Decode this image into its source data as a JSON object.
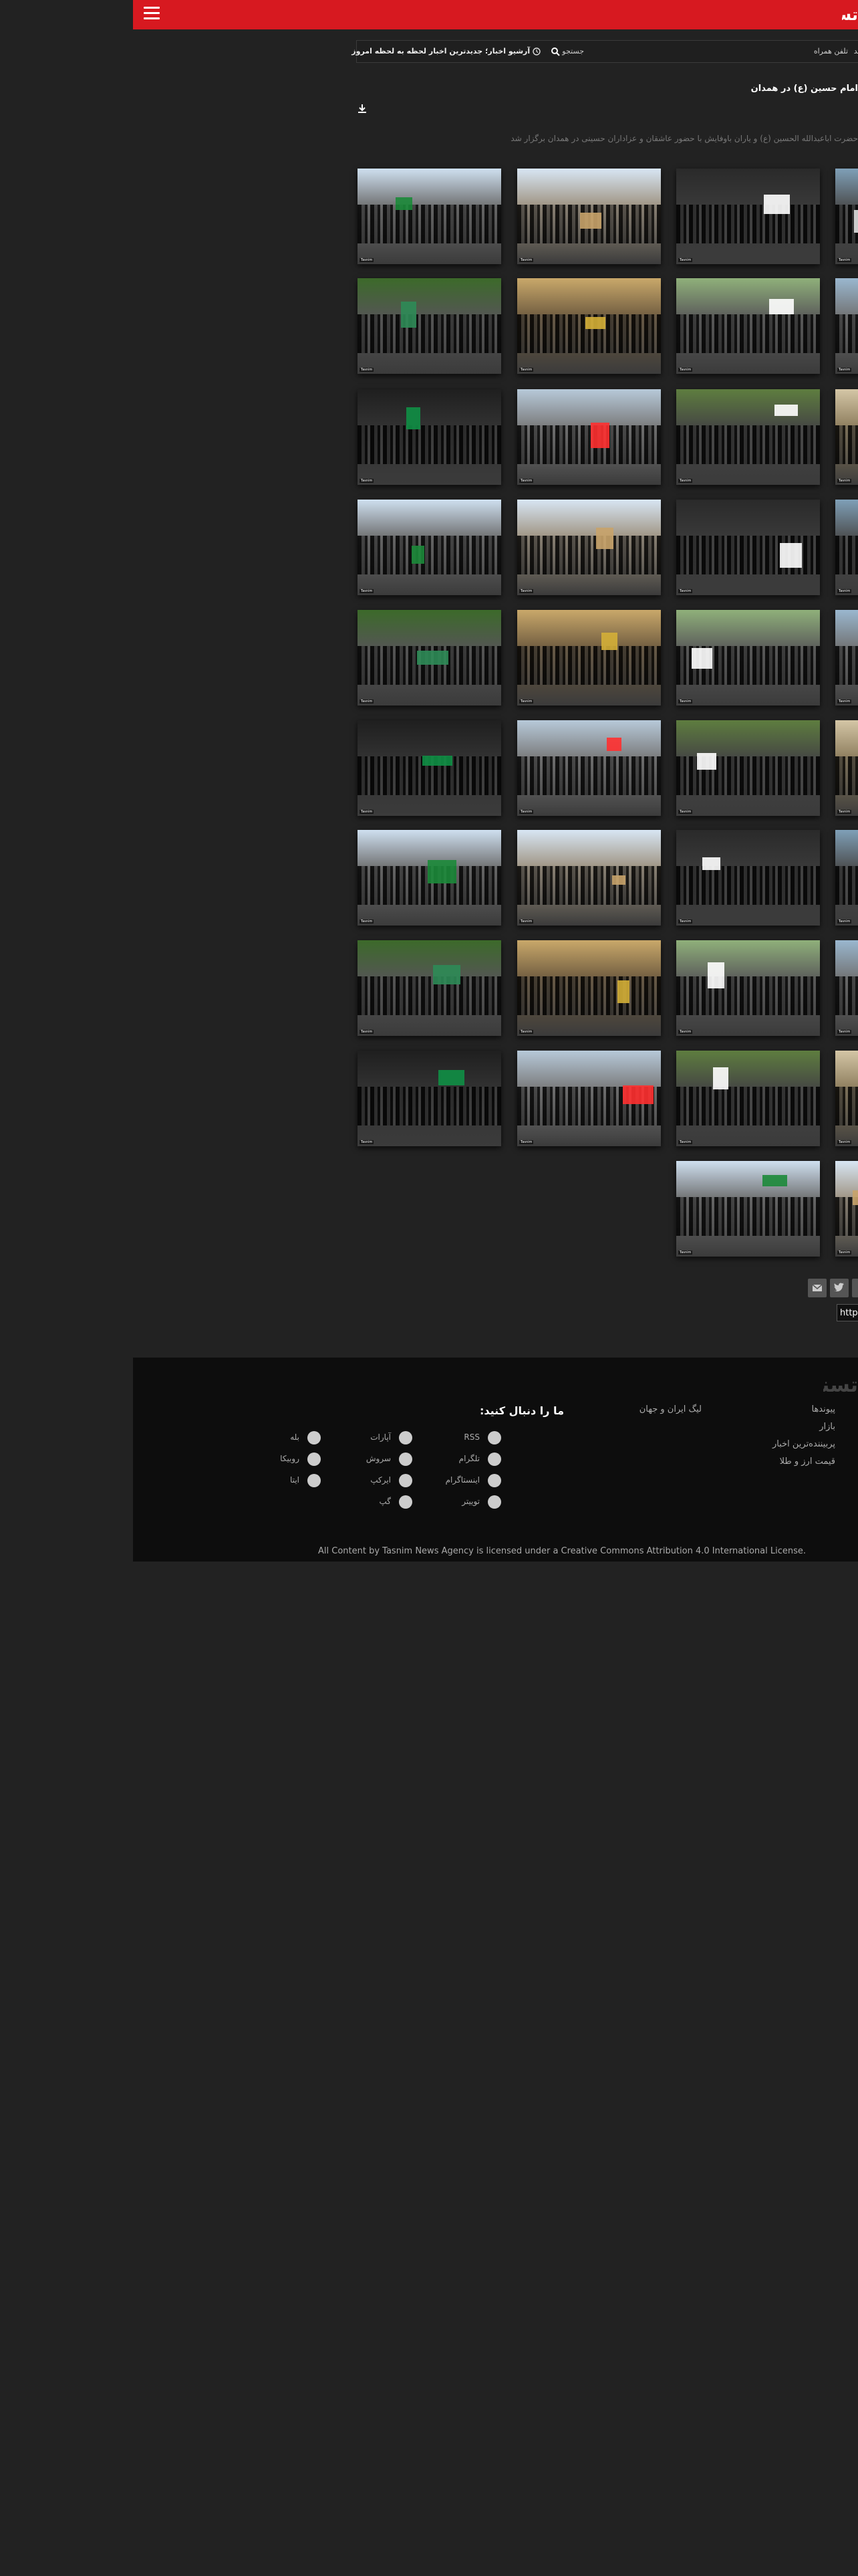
{
  "header": {
    "logo_text": "تسنیم",
    "menu_icon": "hamburger-icon",
    "accent_color": "#d71920"
  },
  "searchbar": {
    "cut_text": "جلد",
    "mobile_label": "تلفن همراه",
    "search_label": "جستجو",
    "archive_label": "آرشیو اخبار؛ جدیدترین اخبار لحظه به لحظه امروز"
  },
  "article": {
    "title": "امام حسین (ع) در همدان",
    "lead": "حضرت اباعبدالله الحسین (ع) و یاران باوفایش با حضور عاشقان و عزاداران حسینی در همدان برگزار شد"
  },
  "gallery": {
    "caption": "Tasnim"
  },
  "share": {
    "url_value": "http",
    "buttons": [
      "envelope-icon",
      "twitter-icon",
      "share-icon"
    ]
  },
  "footer": {
    "logo_text": "تسنیم",
    "col_links": [
      "پیوندها",
      "بازار",
      "پربیننده‌ترین اخبار",
      "قیمت ارز و طلا"
    ],
    "league_link": "لیگ ایران و جهان",
    "follow_title": "ما را دنبال کنید:",
    "socials": [
      {
        "name": "RSS",
        "icon": "rss-icon"
      },
      {
        "name": "آپارات",
        "icon": "aparat-icon"
      },
      {
        "name": "بله",
        "icon": "bale-icon"
      },
      {
        "name": "تلگرام",
        "icon": "telegram-icon"
      },
      {
        "name": "سروش",
        "icon": "soroush-icon"
      },
      {
        "name": "روبیکا",
        "icon": "rubika-icon"
      },
      {
        "name": "اینستاگرام",
        "icon": "instagram-icon"
      },
      {
        "name": "ایرکپ",
        "icon": "igap-icon"
      },
      {
        "name": "ایتا",
        "icon": "eitaa-icon"
      },
      {
        "name": "توییتر",
        "icon": "twitter-icon"
      },
      {
        "name": "گپ",
        "icon": "gap-icon"
      }
    ],
    "license": "All Content by Tasnim News Agency is licensed under a Creative Commons Attribution 4.0 International License."
  }
}
